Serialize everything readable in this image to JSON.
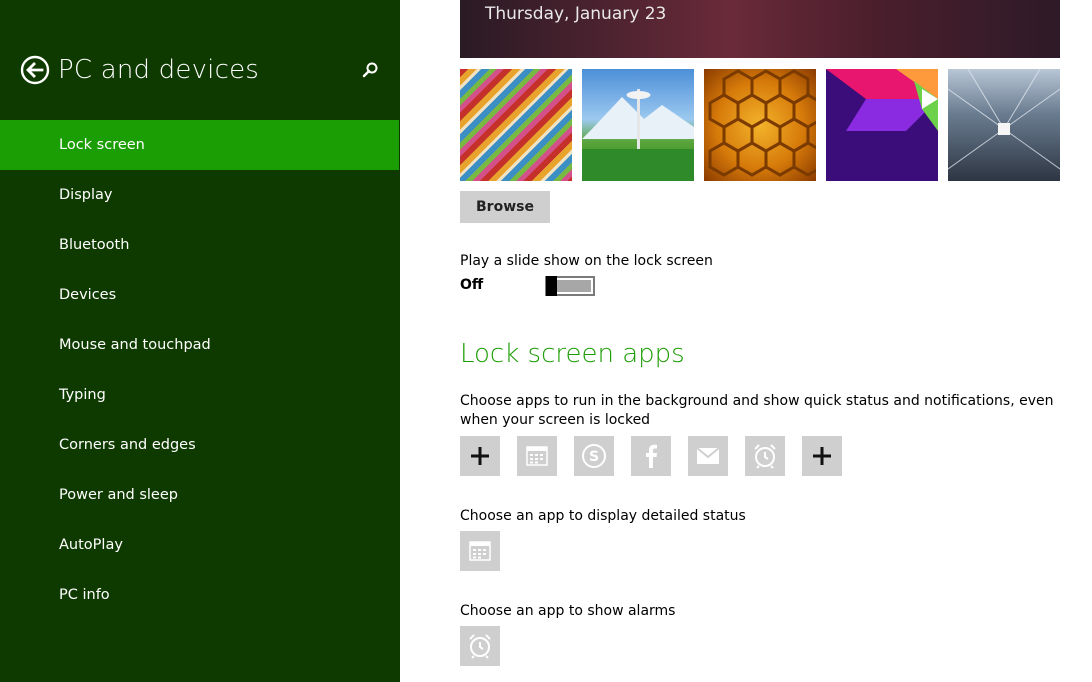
{
  "sidebar": {
    "title": "PC and devices",
    "items": [
      {
        "label": "Lock screen",
        "active": true
      },
      {
        "label": "Display"
      },
      {
        "label": "Bluetooth"
      },
      {
        "label": "Devices"
      },
      {
        "label": "Mouse and touchpad"
      },
      {
        "label": "Typing"
      },
      {
        "label": "Corners and edges"
      },
      {
        "label": "Power and sleep"
      },
      {
        "label": "AutoPlay"
      },
      {
        "label": "PC info"
      }
    ]
  },
  "preview": {
    "date": "Thursday, January 23"
  },
  "browse_label": "Browse",
  "slideshow": {
    "label": "Play a slide show on the lock screen",
    "state": "Off"
  },
  "lock_apps": {
    "title": "Lock screen apps",
    "description": "Choose apps to run in the background and show quick status and notifications, even when your screen is locked",
    "tiles": [
      "add-icon",
      "calendar-icon",
      "skype-icon",
      "facebook-icon",
      "mail-icon",
      "alarm-icon",
      "add-icon"
    ]
  },
  "detailed_status": {
    "label": "Choose an app to display detailed status",
    "app": "calendar-icon"
  },
  "alarms": {
    "label": "Choose an app to show alarms",
    "app": "alarm-icon"
  },
  "colors": {
    "sidebar_bg": "#0e3a00",
    "accent": "#1b9e04",
    "tile_bg": "#cfcfcf"
  }
}
